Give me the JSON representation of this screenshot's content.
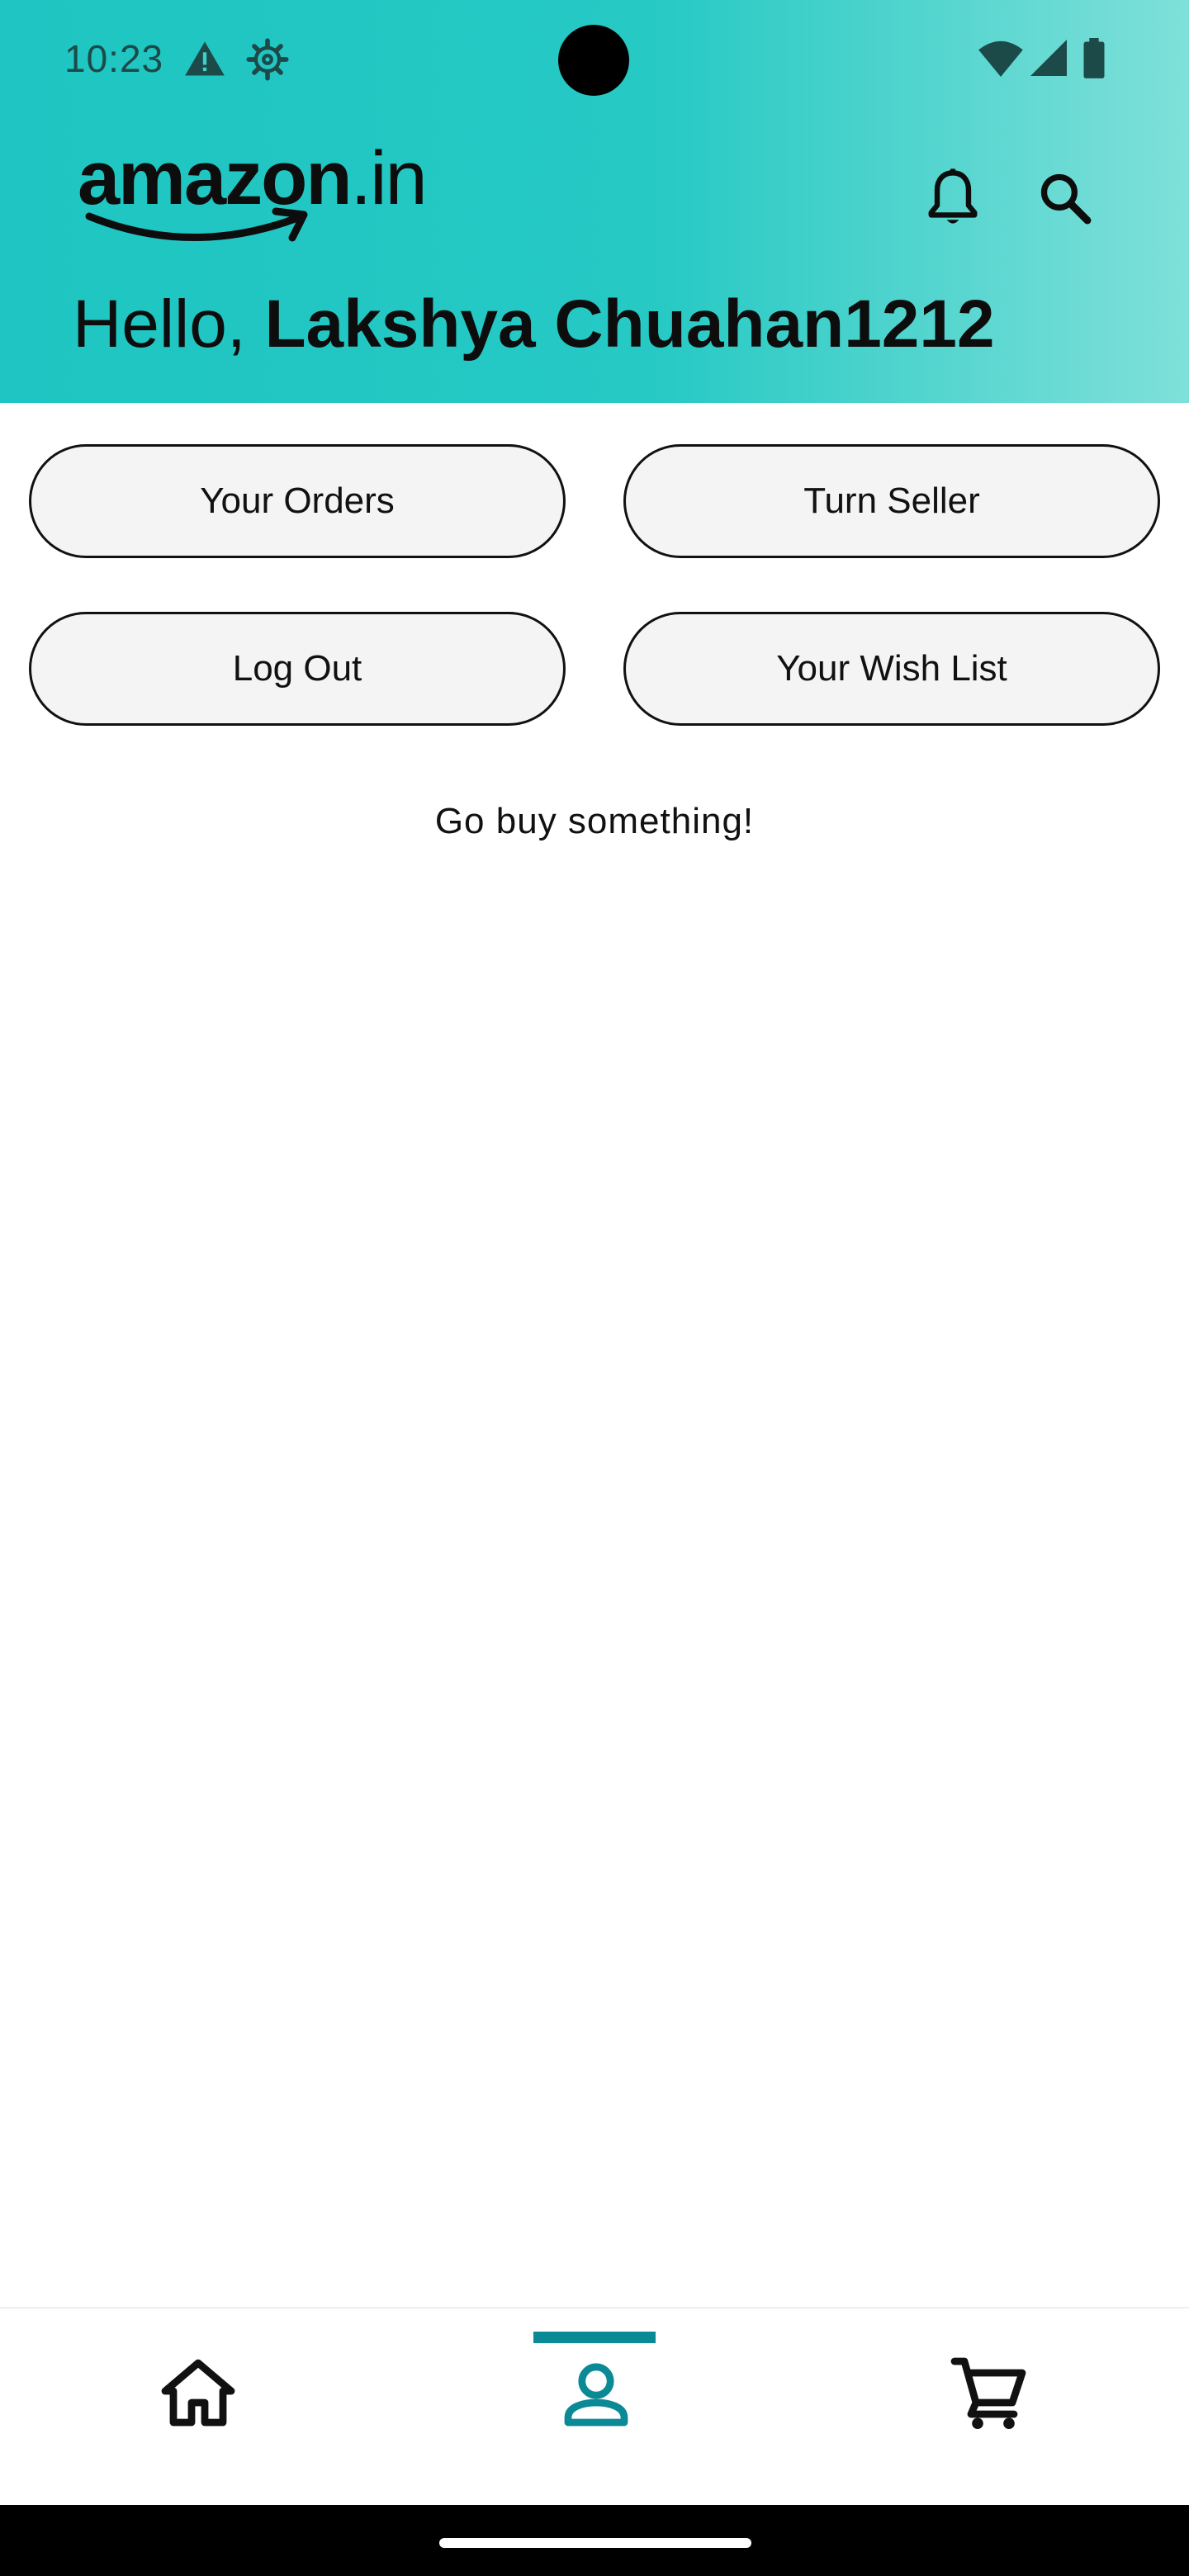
{
  "status_bar": {
    "time": "10:23",
    "left_icons": [
      "warning-icon",
      "settings-gear-icon"
    ],
    "right_icons": [
      "wifi-icon",
      "cellular-signal-icon",
      "battery-icon"
    ]
  },
  "app_bar": {
    "logo_main": "amazon",
    "logo_suffix": ".in",
    "actions": [
      "notifications-bell-icon",
      "search-icon"
    ],
    "accent_gradient": [
      "#1ec5c2",
      "#7fe0d9"
    ]
  },
  "greeting": {
    "prefix": "Hello, ",
    "name": "Lakshya Chuahan1212"
  },
  "account_actions": {
    "your_orders": "Your Orders",
    "turn_seller": "Turn Seller",
    "log_out": "Log Out",
    "wish_list": "Your Wish List"
  },
  "orders_section": {
    "empty_message": "Go buy something!"
  },
  "bottom_nav": {
    "items": [
      "home-icon",
      "account-icon",
      "cart-icon"
    ],
    "selected": "account-icon",
    "selected_color": "#0b8a96"
  }
}
